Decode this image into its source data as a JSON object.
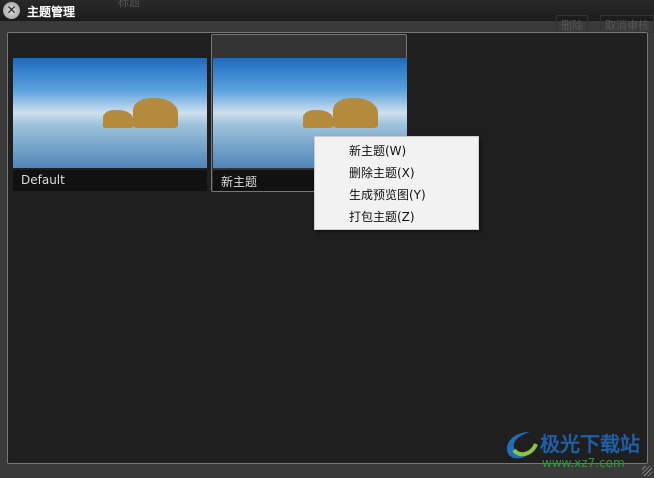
{
  "window": {
    "title": "主题管理",
    "background_title": "标题",
    "background_buttons": [
      "删除",
      "取消审核"
    ]
  },
  "themes": [
    {
      "name": "Default",
      "selected": false
    },
    {
      "name": "新主题",
      "selected": true
    }
  ],
  "context_menu": [
    "新主题(W)",
    "删除主题(X)",
    "生成预览图(Y)",
    "打包主题(Z)"
  ],
  "watermark": {
    "name": "极光下载站",
    "url": "www.xz7.com"
  }
}
